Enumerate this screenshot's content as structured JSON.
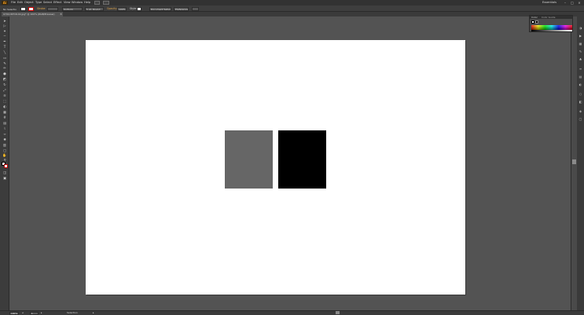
{
  "app": {
    "logo": "Ai",
    "workspace": "Essentials"
  },
  "menu": [
    "File",
    "Edit",
    "Object",
    "Type",
    "Select",
    "Effect",
    "View",
    "Window",
    "Help"
  ],
  "control_bar": {
    "selection_label": "No Selection",
    "stroke_label": "Stroke:",
    "opacity_label": "Opacity:",
    "opacity_value": "100%",
    "style_label": "Style:",
    "uniform_value": "Uniform",
    "brush_value": "5 pt. Round",
    "document_setup": "Document Setup",
    "preferences": "Preferences"
  },
  "document": {
    "tab_title": "0701CDYCR-02.jpg* @ 100% (RGB/Preview)",
    "close": "×"
  },
  "artwork": {
    "rect1_color": "#666666",
    "rect2_color": "#000000",
    "artboard_color": "#ffffff"
  },
  "color_panel": {
    "title": "Color",
    "tab2": "Color Guide"
  },
  "status_bar": {
    "zoom": "100%",
    "artboard_number": "1",
    "tool_name": "Selection"
  },
  "icons": {
    "tools": [
      "selection-tool",
      "direct-selection-tool",
      "magic-wand-tool",
      "lasso-tool",
      "pen-tool",
      "type-tool",
      "line-tool",
      "rectangle-tool",
      "paintbrush-tool",
      "pencil-tool",
      "blob-brush-tool",
      "eraser-tool",
      "rotate-tool",
      "scale-tool",
      "width-tool",
      "free-transform-tool",
      "shape-builder-tool",
      "perspective-grid-tool",
      "mesh-tool",
      "gradient-tool",
      "eyedropper-tool",
      "blend-tool",
      "symbol-sprayer-tool",
      "column-graph-tool",
      "artboard-tool",
      "slice-tool",
      "hand-tool",
      "zoom-tool"
    ]
  }
}
